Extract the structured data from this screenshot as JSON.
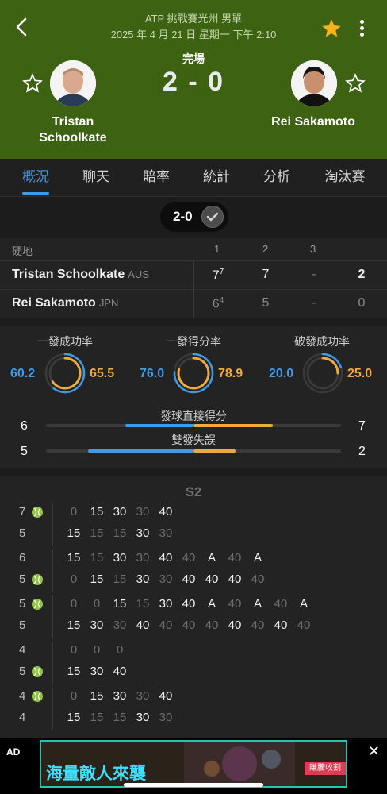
{
  "header": {
    "title": "ATP 挑戰賽光州 男單",
    "date": "2025 年 4 月 21 日 星期一 下午 2:10",
    "status": "完場",
    "score": "2 - 0",
    "player1": "Tristan Schoolkate",
    "player2": "Rei Sakamoto"
  },
  "tabs": [
    "概況",
    "聊天",
    "賠率",
    "統計",
    "分析",
    "淘汰賽"
  ],
  "result_pill": "2-0",
  "set_table": {
    "surface": "硬地",
    "set_headers": [
      "1",
      "2",
      "3"
    ],
    "rows": [
      {
        "name": "Tristan Schoolkate",
        "country": "AUS",
        "s1": "7",
        "s1_tb": "7",
        "s2": "7",
        "s3": "-",
        "total": "2"
      },
      {
        "name": "Rei Sakamoto",
        "country": "JPN",
        "s1": "6",
        "s1_tb": "4",
        "s2": "5",
        "s3": "-",
        "total": "0"
      }
    ]
  },
  "stats": {
    "rings": [
      {
        "label": "一發成功率",
        "left": "60.2",
        "right": "65.5"
      },
      {
        "label": "一發得分率",
        "left": "76.0",
        "right": "78.9"
      },
      {
        "label": "破發成功率",
        "left": "20.0",
        "right": "25.0"
      }
    ],
    "bars": [
      {
        "label": "發球直接得分",
        "left": "6",
        "right": "7",
        "left_value": 6,
        "right_value": 7
      },
      {
        "label": "雙發失誤",
        "left": "5",
        "right": "2",
        "left_value": 5,
        "right_value": 2
      }
    ]
  },
  "pbp": {
    "set_label": "S2",
    "games": [
      {
        "top_score": "7",
        "bottom_score": "5",
        "server": "top",
        "top": [
          [
            "0",
            "g"
          ],
          [
            "15",
            "w"
          ],
          [
            "30",
            "w"
          ],
          [
            "30",
            "g"
          ],
          [
            "40",
            "w"
          ]
        ],
        "bottom": [
          [
            "15",
            "w"
          ],
          [
            "15",
            "g"
          ],
          [
            "15",
            "g"
          ],
          [
            "30",
            "w"
          ],
          [
            "30",
            "g"
          ]
        ]
      },
      {
        "top_score": "6",
        "bottom_score": "5",
        "server": "bottom",
        "top": [
          [
            "15",
            "w"
          ],
          [
            "15",
            "g"
          ],
          [
            "30",
            "w"
          ],
          [
            "30",
            "g"
          ],
          [
            "40",
            "w"
          ],
          [
            "40",
            "g"
          ],
          [
            "A",
            "w"
          ],
          [
            "40",
            "g"
          ],
          [
            "A",
            "w"
          ]
        ],
        "bottom": [
          [
            "0",
            "g"
          ],
          [
            "15",
            "w"
          ],
          [
            "15",
            "g"
          ],
          [
            "30",
            "w"
          ],
          [
            "30",
            "g"
          ],
          [
            "40",
            "w"
          ],
          [
            "40",
            "w"
          ],
          [
            "40",
            "w"
          ],
          [
            "40",
            "g"
          ]
        ]
      },
      {
        "top_score": "5",
        "bottom_score": "5",
        "server": "top",
        "top": [
          [
            "0",
            "g"
          ],
          [
            "0",
            "g"
          ],
          [
            "15",
            "w"
          ],
          [
            "15",
            "g"
          ],
          [
            "30",
            "w"
          ],
          [
            "40",
            "w"
          ],
          [
            "A",
            "w"
          ],
          [
            "40",
            "g"
          ],
          [
            "A",
            "w"
          ],
          [
            "40",
            "g"
          ],
          [
            "A",
            "w"
          ]
        ],
        "bottom": [
          [
            "15",
            "w"
          ],
          [
            "30",
            "w"
          ],
          [
            "30",
            "g"
          ],
          [
            "40",
            "w"
          ],
          [
            "40",
            "g"
          ],
          [
            "40",
            "g"
          ],
          [
            "40",
            "g"
          ],
          [
            "40",
            "w"
          ],
          [
            "40",
            "g"
          ],
          [
            "40",
            "w"
          ],
          [
            "40",
            "g"
          ]
        ]
      },
      {
        "top_score": "4",
        "bottom_score": "5",
        "server": "bottom",
        "top": [
          [
            "0",
            "g"
          ],
          [
            "0",
            "g"
          ],
          [
            "0",
            "g"
          ]
        ],
        "bottom": [
          [
            "15",
            "w"
          ],
          [
            "30",
            "w"
          ],
          [
            "40",
            "w"
          ]
        ]
      },
      {
        "top_score": "4",
        "bottom_score": "4",
        "server": "top",
        "top": [
          [
            "0",
            "g"
          ],
          [
            "15",
            "w"
          ],
          [
            "30",
            "w"
          ],
          [
            "30",
            "g"
          ],
          [
            "40",
            "w"
          ]
        ],
        "bottom": [
          [
            "15",
            "w"
          ],
          [
            "15",
            "g"
          ],
          [
            "15",
            "g"
          ],
          [
            "30",
            "w"
          ],
          [
            "30",
            "g"
          ]
        ]
      }
    ]
  },
  "ad": {
    "label": "AD",
    "close": "✕",
    "text": "海量敵人來襲",
    "cta": "賺騰收割"
  },
  "colors": {
    "header_bg": "#3d6212",
    "accent_blue": "#3d9be9",
    "accent_orange": "#f0a93c",
    "ball_green": "#8ec63f",
    "star_gold": "#f5b21b"
  }
}
